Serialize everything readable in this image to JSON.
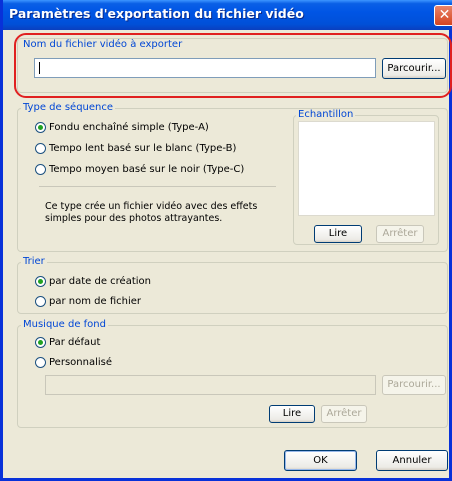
{
  "window": {
    "title": "Paramètres d'exportation du fichier vidéo"
  },
  "export_file": {
    "legend": "Nom du fichier vidéo à exporter",
    "value": "",
    "browse_label": "Parcourir..."
  },
  "sequence": {
    "legend": "Type de séquence",
    "options": [
      {
        "label": "Fondu enchaîné simple (Type-A)",
        "selected": true
      },
      {
        "label": "Tempo lent basé sur le blanc (Type-B)",
        "selected": false
      },
      {
        "label": "Tempo moyen basé sur le noir (Type-C)",
        "selected": false
      }
    ],
    "description_line1": "Ce type crée un fichier vidéo avec des effets",
    "description_line2": "simples pour des photos attrayantes.",
    "sample_legend": "Echantillon",
    "play_label": "Lire",
    "stop_label": "Arrêter"
  },
  "sort": {
    "legend": "Trier",
    "options": [
      {
        "label": "par date de création",
        "selected": true
      },
      {
        "label": "par nom de fichier",
        "selected": false
      }
    ]
  },
  "music": {
    "legend": "Musique de fond",
    "options": [
      {
        "label": "Par défaut",
        "selected": true
      },
      {
        "label": "Personnalisé",
        "selected": false
      }
    ],
    "path_value": "",
    "browse_label": "Parcourir...",
    "play_label": "Lire",
    "stop_label": "Arrêter"
  },
  "footer": {
    "ok_label": "OK",
    "cancel_label": "Annuler"
  },
  "colors": {
    "titlebar": "#0055e5",
    "dialog_bg": "#ece9d8",
    "legend_text": "#0046d5",
    "highlight": "#e02020",
    "radio_dot": "#21a121"
  },
  "icons": {
    "close": "close-icon"
  }
}
